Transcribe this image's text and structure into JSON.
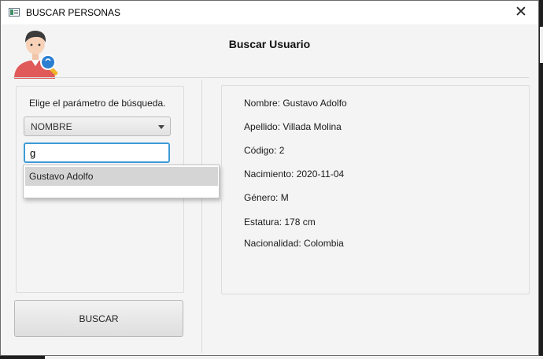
{
  "window": {
    "title": "BUSCAR PERSONAS",
    "close_glyph": "✕"
  },
  "header": {
    "title": "Buscar Usuario",
    "avatar_icon": "user-search-icon"
  },
  "search": {
    "param_label": "Elige el parámetro de búsqueda.",
    "param_selected": "NOMBRE",
    "query_value": "g",
    "suggestions": [
      "Gustavo Adolfo"
    ],
    "button_label": "BUSCAR"
  },
  "result": {
    "nombre": "Nombre: Gustavo Adolfo",
    "apellido": "Apellido: Villada Molina",
    "codigo": "Código: 2",
    "nacimiento": "Nacimiento: 2020-11-04",
    "genero": "Género: M",
    "estatura": "Estatura: 178 cm",
    "nacionalidad": "Nacionalidad: Colombia"
  },
  "colors": {
    "focus_border": "#3e9bd8",
    "suggestion_highlight": "#d5d5d5",
    "avatar_shirt": "#e05a5a",
    "avatar_hair": "#3b3b3b",
    "magnifier": "#2b7fd0"
  }
}
